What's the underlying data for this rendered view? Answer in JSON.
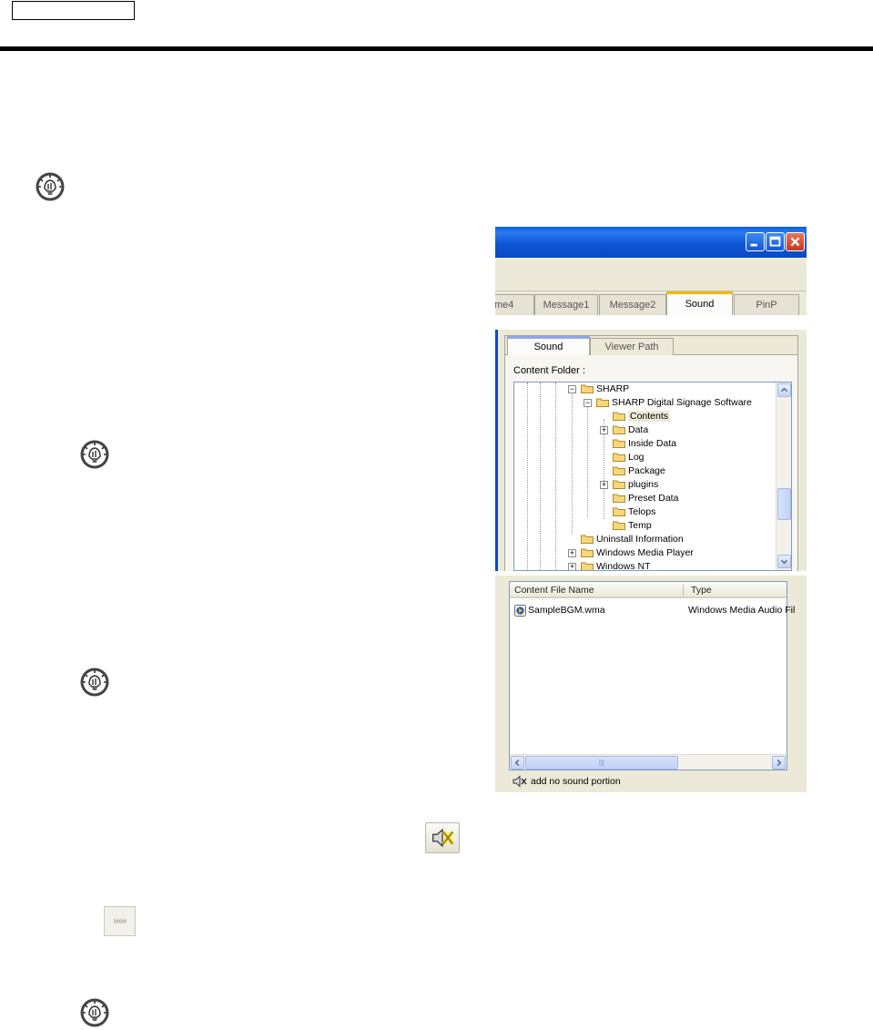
{
  "page": {
    "header_box_text": ""
  },
  "icons": {
    "tip": "lightbulb-hint-icon",
    "mute": "speaker-mute-icon",
    "expand": "double-chevron-right-icon"
  },
  "window": {
    "tabs": [
      "me4",
      "Message1",
      "Message2",
      "Sound",
      "PinP"
    ],
    "active_tab": "Sound"
  },
  "sound_panel": {
    "tabs": [
      "Sound",
      "Viewer Path"
    ],
    "active_tab": "Sound",
    "content_folder_label": "Content Folder :",
    "tree": [
      {
        "label": "SHARP",
        "level": 0,
        "expander": "minus"
      },
      {
        "label": "SHARP Digital Signage Software",
        "level": 1,
        "expander": "minus"
      },
      {
        "label": "Contents",
        "level": 2,
        "expander": "",
        "selected": true
      },
      {
        "label": "Data",
        "level": 2,
        "expander": "plus"
      },
      {
        "label": "Inside Data",
        "level": 2,
        "expander": ""
      },
      {
        "label": "Log",
        "level": 2,
        "expander": ""
      },
      {
        "label": "Package",
        "level": 2,
        "expander": ""
      },
      {
        "label": "plugins",
        "level": 2,
        "expander": "plus"
      },
      {
        "label": "Preset Data",
        "level": 2,
        "expander": ""
      },
      {
        "label": "Telops",
        "level": 2,
        "expander": ""
      },
      {
        "label": "Temp",
        "level": 2,
        "expander": ""
      },
      {
        "label": "Uninstall Information",
        "level": 0,
        "expander": ""
      },
      {
        "label": "Windows Media Player",
        "level": 0,
        "expander": "plus"
      },
      {
        "label": "Windows NT",
        "level": 0,
        "expander": "plus"
      }
    ]
  },
  "file_list": {
    "columns": [
      "Content File Name",
      "Type"
    ],
    "rows": [
      {
        "name": "SampleBGM.wma",
        "type": "Windows Media Audio Fil"
      }
    ],
    "no_sound_label": "add no sound portion"
  },
  "expand_button_label": "»»»"
}
